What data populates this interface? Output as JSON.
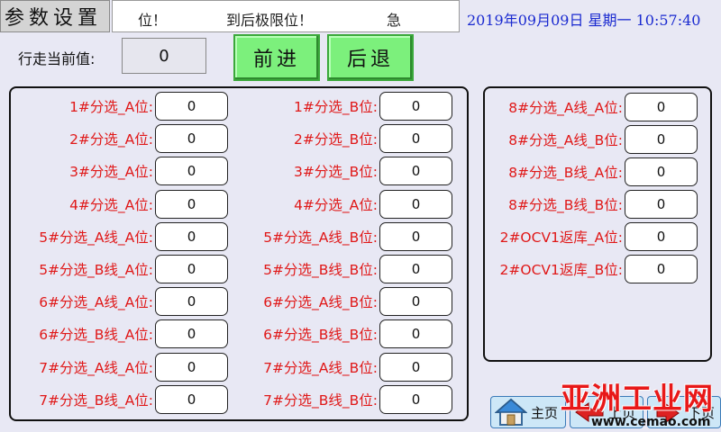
{
  "header": {
    "title": "参数设置",
    "alarm_ticker": [
      "位！",
      "到后极限位！",
      "急"
    ],
    "datetime": "2019年09月09日 星期一 10:57:40"
  },
  "travel": {
    "label": "行走当前值:",
    "value": "0"
  },
  "buttons": {
    "forward": "前进",
    "backward": "后退"
  },
  "left_panel": {
    "col1": [
      {
        "label": "1#分选_A位:",
        "value": "0"
      },
      {
        "label": "2#分选_A位:",
        "value": "0"
      },
      {
        "label": "3#分选_A位:",
        "value": "0"
      },
      {
        "label": "4#分选_A位:",
        "value": "0"
      },
      {
        "label": "5#分选_A线_A位:",
        "value": "0"
      },
      {
        "label": "5#分选_B线_A位:",
        "value": "0"
      },
      {
        "label": "6#分选_A线_A位:",
        "value": "0"
      },
      {
        "label": "6#分选_B线_A位:",
        "value": "0"
      },
      {
        "label": "7#分选_A线_A位:",
        "value": "0"
      },
      {
        "label": "7#分选_B线_A位:",
        "value": "0"
      }
    ],
    "col2": [
      {
        "label": "1#分选_B位:",
        "value": "0"
      },
      {
        "label": "2#分选_B位:",
        "value": "0"
      },
      {
        "label": "3#分选_B位:",
        "value": "0"
      },
      {
        "label": "4#分选_A位:",
        "value": "0"
      },
      {
        "label": "5#分选_A线_B位:",
        "value": "0"
      },
      {
        "label": "5#分选_B线_B位:",
        "value": "0"
      },
      {
        "label": "6#分选_A线_B位:",
        "value": "0"
      },
      {
        "label": "6#分选_B线_B位:",
        "value": "0"
      },
      {
        "label": "7#分选_A线_B位:",
        "value": "0"
      },
      {
        "label": "7#分选_B线_B位:",
        "value": "0"
      }
    ]
  },
  "right_panel": [
    {
      "label": "8#分选_A线_A位:",
      "value": "0"
    },
    {
      "label": "8#分选_A线_B位:",
      "value": "0"
    },
    {
      "label": "8#分选_B线_A位:",
      "value": "0"
    },
    {
      "label": "8#分选_B线_B位:",
      "value": "0"
    },
    {
      "label": "2#OCV1返库_A位:",
      "value": "0"
    },
    {
      "label": "2#OCV1返库_B位:",
      "value": "0"
    }
  ],
  "nav": {
    "home": "主页",
    "prev": "上页",
    "next": "下页"
  },
  "watermark": {
    "text": "亚洲工业网",
    "url": "www.cemao.com"
  },
  "colors": {
    "label_red": "#e01818",
    "datetime_blue": "#1a2ad0",
    "button_green": "#7cf07c",
    "background": "#e8e8f4"
  }
}
